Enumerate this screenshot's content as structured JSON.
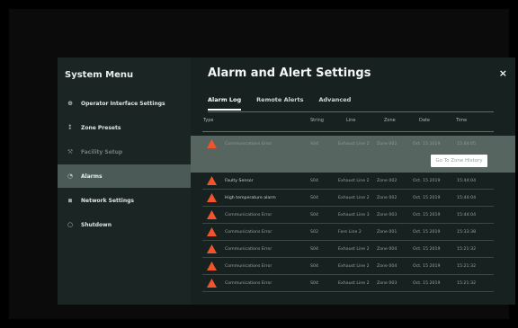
{
  "sidebar": {
    "title": "System Menu",
    "items": [
      {
        "label": "Operator Interface Settings",
        "icon": "globe-icon",
        "glyph": "⊕"
      },
      {
        "label": "Zone Presets",
        "icon": "preset-icon",
        "glyph": "⁑"
      },
      {
        "label": "Facility Setup",
        "icon": "tools-icon",
        "glyph": "⚒"
      },
      {
        "label": "Alarms",
        "icon": "alarm-icon",
        "glyph": "◔"
      },
      {
        "label": "Network Settings",
        "icon": "network-icon",
        "glyph": "⧈"
      },
      {
        "label": "Shutdown",
        "icon": "power-icon",
        "glyph": "○"
      }
    ]
  },
  "main": {
    "title": "Alarm and Alert Settings",
    "close": "×",
    "tabs": [
      "Alarm Log",
      "Remote Alerts",
      "Advanced"
    ],
    "headers": [
      "Type",
      "String",
      "Line",
      "Zone",
      "Date",
      "Time"
    ],
    "rows": [
      {
        "type": "Communications Error",
        "string": "S04",
        "line": "Exhaust Line 2",
        "zone": "Zone 002",
        "date": "Oct. 15 2019",
        "time": "15:44:05"
      },
      {
        "type": "Faulty Sensor",
        "string": "S04",
        "line": "Exhaust Line 2",
        "zone": "Zone 002",
        "date": "Oct. 15 2019",
        "time": "15:44:04"
      },
      {
        "type": "High temperature alarm",
        "string": "S04",
        "line": "Exhaust Line 2",
        "zone": "Zone 002",
        "date": "Oct. 15 2019",
        "time": "15:44:04"
      },
      {
        "type": "Communications Error",
        "string": "S04",
        "line": "Exhaust Line 3",
        "zone": "Zone 003",
        "date": "Oct. 15 2019",
        "time": "15:44:04"
      },
      {
        "type": "Communications Error",
        "string": "S02",
        "line": "Fore Line 2",
        "zone": "Zone 001",
        "date": "Oct. 15 2019",
        "time": "15:33:38"
      },
      {
        "type": "Communications Error",
        "string": "S04",
        "line": "Exhaust Line 2",
        "zone": "Zone 004",
        "date": "Oct. 15 2019",
        "time": "15:21:32"
      },
      {
        "type": "Communications Error",
        "string": "S04",
        "line": "Exhaust Line 2",
        "zone": "Zone 004",
        "date": "Oct. 15 2019",
        "time": "15:21:32"
      },
      {
        "type": "Communications Error",
        "string": "S04",
        "line": "Exhaust Line 2",
        "zone": "Zone 003",
        "date": "Oct. 15 2019",
        "time": "15:21:32"
      }
    ],
    "go_button": "Go To Zone History"
  },
  "colors": {
    "warning": "#f0542c",
    "active_row": "#56655f",
    "active_menu": "#4b5a56"
  }
}
